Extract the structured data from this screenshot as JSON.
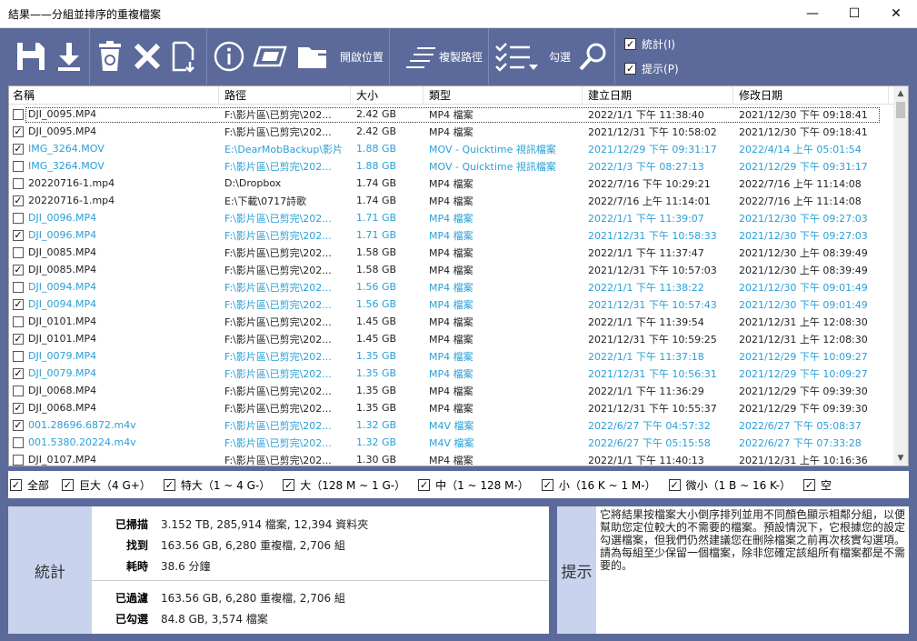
{
  "window": {
    "title": "結果——分組並排序的重複檔案",
    "minimize": "—",
    "maximize": "☐",
    "close": "✕"
  },
  "toolbar": {
    "open_location_label": "開啟位置",
    "copy_path_label": "複製路徑",
    "check_label": "勾選",
    "stats_toggle": {
      "label": "統計(I)",
      "checked": true
    },
    "hint_toggle": {
      "label": "提示(P)",
      "checked": true
    }
  },
  "table": {
    "columns": [
      "名稱",
      "路徑",
      "大小",
      "類型",
      "建立日期",
      "修改日期"
    ],
    "rows": [
      {
        "checked": false,
        "blue": false,
        "name": "DJI_0095.MP4",
        "path": "F:\\影片區\\已剪完\\202...",
        "size": "2.42 GB",
        "type": "MP4 檔案",
        "created": "2022/1/1 下午 11:38:40",
        "modified": "2021/12/30 下午 09:18:41"
      },
      {
        "checked": true,
        "blue": false,
        "name": "DJI_0095.MP4",
        "path": "F:\\影片區\\已剪完\\202...",
        "size": "2.42 GB",
        "type": "MP4 檔案",
        "created": "2021/12/31 下午 10:58:02",
        "modified": "2021/12/30 下午 09:18:41"
      },
      {
        "checked": true,
        "blue": true,
        "name": "IMG_3264.MOV",
        "path": "E:\\DearMobBackup\\影片",
        "size": "1.88 GB",
        "type": "MOV - Quicktime 視訊檔案",
        "created": "2021/12/29 下午 09:31:17",
        "modified": "2022/4/14 上午 05:01:54"
      },
      {
        "checked": false,
        "blue": true,
        "name": "IMG_3264.MOV",
        "path": "F:\\影片區\\已剪完\\202...",
        "size": "1.88 GB",
        "type": "MOV - Quicktime 視訊檔案",
        "created": "2022/1/3 下午 08:27:13",
        "modified": "2021/12/29 下午 09:31:17"
      },
      {
        "checked": false,
        "blue": false,
        "name": "20220716-1.mp4",
        "path": "D:\\Dropbox",
        "size": "1.74 GB",
        "type": "MP4 檔案",
        "created": "2022/7/16 下午 10:29:21",
        "modified": "2022/7/16 上午 11:14:08"
      },
      {
        "checked": true,
        "blue": false,
        "name": "20220716-1.mp4",
        "path": "E:\\下載\\0717詩歌",
        "size": "1.74 GB",
        "type": "MP4 檔案",
        "created": "2022/7/16 上午 11:14:01",
        "modified": "2022/7/16 上午 11:14:08"
      },
      {
        "checked": false,
        "blue": true,
        "name": "DJI_0096.MP4",
        "path": "F:\\影片區\\已剪完\\202...",
        "size": "1.71 GB",
        "type": "MP4 檔案",
        "created": "2022/1/1 下午 11:39:07",
        "modified": "2021/12/30 下午 09:27:03"
      },
      {
        "checked": true,
        "blue": true,
        "name": "DJI_0096.MP4",
        "path": "F:\\影片區\\已剪完\\202...",
        "size": "1.71 GB",
        "type": "MP4 檔案",
        "created": "2021/12/31 下午 10:58:33",
        "modified": "2021/12/30 下午 09:27:03"
      },
      {
        "checked": false,
        "blue": false,
        "name": "DJI_0085.MP4",
        "path": "F:\\影片區\\已剪完\\202...",
        "size": "1.58 GB",
        "type": "MP4 檔案",
        "created": "2022/1/1 下午 11:37:47",
        "modified": "2021/12/30 上午 08:39:49"
      },
      {
        "checked": true,
        "blue": false,
        "name": "DJI_0085.MP4",
        "path": "F:\\影片區\\已剪完\\202...",
        "size": "1.58 GB",
        "type": "MP4 檔案",
        "created": "2021/12/31 下午 10:57:03",
        "modified": "2021/12/30 上午 08:39:49"
      },
      {
        "checked": false,
        "blue": true,
        "name": "DJI_0094.MP4",
        "path": "F:\\影片區\\已剪完\\202...",
        "size": "1.56 GB",
        "type": "MP4 檔案",
        "created": "2022/1/1 下午 11:38:22",
        "modified": "2021/12/30 下午 09:01:49"
      },
      {
        "checked": true,
        "blue": true,
        "name": "DJI_0094.MP4",
        "path": "F:\\影片區\\已剪完\\202...",
        "size": "1.56 GB",
        "type": "MP4 檔案",
        "created": "2021/12/31 下午 10:57:43",
        "modified": "2021/12/30 下午 09:01:49"
      },
      {
        "checked": false,
        "blue": false,
        "name": "DJI_0101.MP4",
        "path": "F:\\影片區\\已剪完\\202...",
        "size": "1.45 GB",
        "type": "MP4 檔案",
        "created": "2022/1/1 下午 11:39:54",
        "modified": "2021/12/31 上午 12:08:30"
      },
      {
        "checked": true,
        "blue": false,
        "name": "DJI_0101.MP4",
        "path": "F:\\影片區\\已剪完\\202...",
        "size": "1.45 GB",
        "type": "MP4 檔案",
        "created": "2021/12/31 下午 10:59:25",
        "modified": "2021/12/31 上午 12:08:30"
      },
      {
        "checked": false,
        "blue": true,
        "name": "DJI_0079.MP4",
        "path": "F:\\影片區\\已剪完\\202...",
        "size": "1.35 GB",
        "type": "MP4 檔案",
        "created": "2022/1/1 下午 11:37:18",
        "modified": "2021/12/29 下午 10:09:27"
      },
      {
        "checked": true,
        "blue": true,
        "name": "DJI_0079.MP4",
        "path": "F:\\影片區\\已剪完\\202...",
        "size": "1.35 GB",
        "type": "MP4 檔案",
        "created": "2021/12/31 下午 10:56:31",
        "modified": "2021/12/29 下午 10:09:27"
      },
      {
        "checked": false,
        "blue": false,
        "name": "DJI_0068.MP4",
        "path": "F:\\影片區\\已剪完\\202...",
        "size": "1.35 GB",
        "type": "MP4 檔案",
        "created": "2022/1/1 下午 11:36:29",
        "modified": "2021/12/29 下午 09:39:30"
      },
      {
        "checked": true,
        "blue": false,
        "name": "DJI_0068.MP4",
        "path": "F:\\影片區\\已剪完\\202...",
        "size": "1.35 GB",
        "type": "MP4 檔案",
        "created": "2021/12/31 下午 10:55:37",
        "modified": "2021/12/29 下午 09:39:30"
      },
      {
        "checked": true,
        "blue": true,
        "name": "001.28696.6872.m4v",
        "path": "F:\\影片區\\已剪完\\202...",
        "size": "1.32 GB",
        "type": "M4V 檔案",
        "created": "2022/6/27 下午 04:57:32",
        "modified": "2022/6/27 下午 05:08:37"
      },
      {
        "checked": false,
        "blue": true,
        "name": "001.5380.20224.m4v",
        "path": "F:\\影片區\\已剪完\\202...",
        "size": "1.32 GB",
        "type": "M4V 檔案",
        "created": "2022/6/27 下午 05:15:58",
        "modified": "2022/6/27 下午 07:33:28"
      },
      {
        "checked": false,
        "blue": false,
        "name": "DJI_0107.MP4",
        "path": "F:\\影片區\\已剪完\\202...",
        "size": "1.30 GB",
        "type": "MP4 檔案",
        "created": "2022/1/1 下午 11:40:13",
        "modified": "2021/12/31 上午 10:16:36"
      }
    ]
  },
  "filters": [
    {
      "label": "全部",
      "checked": true
    },
    {
      "label": "巨大（4 G+）",
      "checked": true
    },
    {
      "label": "特大（1 ~ 4 G-）",
      "checked": true
    },
    {
      "label": "大（128 M ~ 1 G-）",
      "checked": true
    },
    {
      "label": "中（1 ~ 128 M-）",
      "checked": true
    },
    {
      "label": "小（16 K ~ 1 M-）",
      "checked": true
    },
    {
      "label": "微小（1 B ~ 16 K-）",
      "checked": true
    },
    {
      "label": "空",
      "checked": true
    }
  ],
  "stats": {
    "title": "統計",
    "rows": [
      {
        "key": "已掃描",
        "value": "3.152 TB, 285,914 檔案, 12,394 資料夾"
      },
      {
        "key": "找到",
        "value": "163.56 GB, 6,280 重複檔, 2,706 組"
      },
      {
        "key": "耗時",
        "value": "38.6 分鐘"
      },
      {
        "key": "已過濾",
        "value": "163.56 GB, 6,280 重複檔, 2,706 組"
      },
      {
        "key": "已勾選",
        "value": "84.8 GB, 3,574 檔案"
      }
    ]
  },
  "hint": {
    "title": "提示",
    "text": "它將結果按檔案大小倒序排列並用不同顏色顯示相鄰分組，以便幫助您定位較大的不需要的檔案。預設情況下，它根據您的設定勾選檔案，但我們仍然建議您在刪除檔案之前再次核實勾選項。請為每組至少保留一個檔案，除非您確定該組所有檔案都是不需要的。"
  },
  "colors": {
    "accent": "#5b6a9b",
    "blue_group": "#2a9fd6",
    "panel_label": "#c9d3ee"
  }
}
